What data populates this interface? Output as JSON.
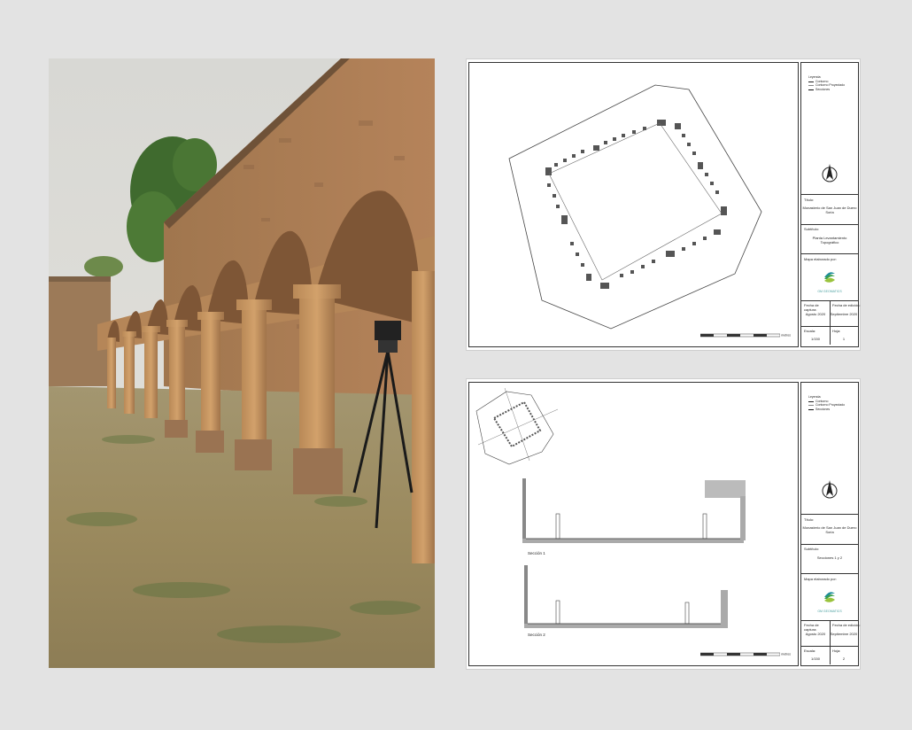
{
  "sheets": [
    {
      "legend": {
        "title": "Leyenda:",
        "items": [
          "Contorno",
          "Contorno Proyectado",
          "Secciones"
        ]
      },
      "title_label": "Título:",
      "title_value": "Monasterio de San Juan de Duero Soria",
      "subtitle_label": "Subtítulo:",
      "subtitle_value": "Planta Levantamiento Topográfico",
      "author_label": "Mapa elaborado por:",
      "logo_text": "GM GEOMATICS",
      "capture_label": "Fecha de captura:",
      "capture_value": "Agosto 2020",
      "edition_label": "Fecha de edición:",
      "edition_value": "Septiembre 2020",
      "scale_label": "Escala:",
      "scale_value": "1/150",
      "sheet_label": "Hoja:",
      "sheet_value": "1",
      "scalebar_unit": "metros"
    },
    {
      "legend": {
        "title": "Leyenda:",
        "items": [
          "Contorno",
          "Contorno Proyectado",
          "Secciones"
        ]
      },
      "title_label": "Título:",
      "title_value": "Monasterio de San Juan de Duero Soria",
      "subtitle_label": "Subtítulo:",
      "subtitle_value": "Secciones 1 y 2",
      "author_label": "Mapa elaborado por:",
      "logo_text": "GM GEOMATICS",
      "capture_label": "Fecha de captura:",
      "capture_value": "Agosto 2020",
      "edition_label": "Fecha de edición:",
      "edition_value": "Septiembre 2020",
      "scale_label": "Escala:",
      "scale_value": "1/150",
      "sheet_label": "Hoja:",
      "sheet_value": "2",
      "scalebar_unit": "metros",
      "section1_label": "Sección 1",
      "section2_label": "Sección 2"
    }
  ]
}
